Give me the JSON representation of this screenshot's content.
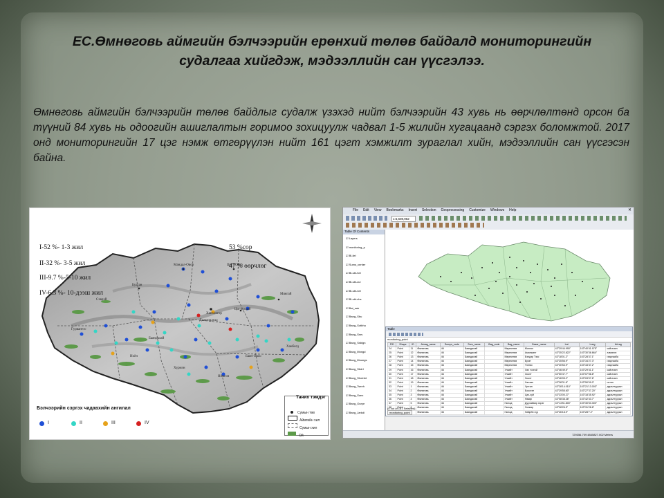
{
  "slide": {
    "title": "ЕС.Өмнөговь аймгийн  бэлчээрийн ерөнхий төлөв байдалд мониторингийн судалгаа  хийгдэж, мэдээллийн сан үүсгэлээ.",
    "paragraph": "Өмнөговь аймгийн бэлчээрийн төлөв байдлыг судалж үзэхэд нийт бэлчээрийн 43 хувь нь өөрчлөлтөнд орсон ба түүний 84 хувь нь одоогийн ашиглалтын горимоо зохицуулж чадвал  1-5 жилийн хугацаанд сэргэх боломжтой. 2017 онд мониторингийн 17 цэг нэмж өтгөрүүлэн нийт 161 цэгт хэмжилт зураглал хийн, мэдээллийн сан үүсгэсэн байна."
  },
  "map": {
    "classes": [
      "I-52 %- 1-3 жил",
      "II-32 %- 3-5 жил",
      "III-9.7 %-5-10 жил",
      "IV-6.3 %- 10-дээш жил"
    ],
    "summary": [
      "53 %сор",
      "47 % өөрчлөг"
    ],
    "place_names": [
      "Мандал-Овоо",
      "Цогт-Овоо",
      "Булган",
      "Сэврэй",
      "Ханбогд",
      "Мянгай",
      "Гурвантэс",
      "Баяндалай",
      "Даланзадгад",
      "Ханхонгор",
      "Цогтцэций",
      "Ноён",
      "Хүрмэн",
      "Баян-Овоо",
      "Номгон"
    ],
    "legend_title": "Таних тэмдэг",
    "legend_items": [
      "Сумын төв",
      "Аймгийн хил",
      "Сумын хил",
      "Ой"
    ],
    "bottom_title": "Бэлчээрийн сэргэх чадавхийн ангилал",
    "bottom_classes": [
      "I",
      "II",
      "III",
      "IV"
    ],
    "class_colors": [
      "#1f4fd6",
      "#33d6c6",
      "#e6a21a",
      "#d62020"
    ]
  },
  "gis": {
    "menu": [
      "File",
      "Edit",
      "View",
      "Bookmarks",
      "Insert",
      "Selection",
      "Geoprocessing",
      "Customize",
      "Windows",
      "Help"
    ],
    "scale": "1:6,608,962",
    "toc_title": "Table Of Contents",
    "layers": [
      "Layers",
      "monitoring_p",
      "Bl-ilel",
      "Sums_center",
      "Bl-ubl-hel",
      "Bl-ubl-zul",
      "Bl-ubl-ner",
      "Bl-ubl-chs",
      "Bai_sair",
      "Bang_Sbu",
      "Bang_Sotbhu",
      "Bang_Ssrs",
      "Bang_Ssblgn",
      "Bang_Mnngd",
      "Bang_Moongs",
      "Bang_Sbdrl",
      "Bang_Shotnbt",
      "Bang_Tseeh",
      "Bang_Sanx",
      "Bang_Ourye",
      "Bang_Jarkdi"
    ],
    "table_title": "Table",
    "table_layer": "monitoring_point",
    "columns": [
      "FID",
      "Shape",
      "ID",
      "Aimag_name",
      "Sumyn_code",
      "Sum_name",
      "Bag_code",
      "Bag_name",
      "Gazar_name",
      "Lat",
      "Long",
      "Urtrag"
    ],
    "rows": [
      [
        "24",
        "Point",
        "11",
        "Өмнөговь",
        "46",
        "Баяндалай",
        "",
        "Мөргөлгөө",
        "Монгол",
        "43°29'44.990\"",
        "103°40'41.975\"",
        "сайгалин"
      ],
      [
        "25",
        "Point",
        "12",
        "Өмнөговь",
        "46",
        "Баяндалай",
        "",
        "Мөргөлгөө",
        "Аманжанг",
        "43°35'22.822\"",
        "103°30'36.664\"",
        "алмагин"
      ],
      [
        "26",
        "Point",
        "13",
        "Өмнөговь",
        "46",
        "Баяндалай",
        "",
        "Мөргөлгөө",
        "Бэлдэр Тэкс",
        "43°18'01.2\"",
        "103°28'37.1\"",
        "гааргааба"
      ],
      [
        "27",
        "Point",
        "14",
        "Өмнөговь",
        "46",
        "Баяндалай",
        "",
        "Мөргөлгөө",
        "Бугат",
        "43°35'56.9\"",
        "103°34'27.3\"",
        "гааргааба"
      ],
      [
        "28",
        "Point",
        "15",
        "Өмнөговь",
        "46",
        "Баяндалай",
        "",
        "Мөргөлгөө",
        "Тэнгис",
        "43°30'54.9\"",
        "103°43'47.2\"",
        "гааргааба"
      ],
      [
        "29",
        "Point",
        "16",
        "Өмнөговь",
        "46",
        "Баяндалай",
        "",
        "Улзийт",
        "Хөх толгой",
        "43°46'49.5\"",
        "103°29'41.1\"",
        "сайгалин"
      ],
      [
        "30",
        "Point",
        "17",
        "Өмнөговь",
        "46",
        "Баяндалай",
        "",
        "Улзийт",
        "Зоолт",
        "43°50'47.7\"",
        "103°07'56.8\"",
        "сайгалин"
      ],
      [
        "31",
        "Point",
        "18",
        "Өмнөговь",
        "46",
        "Баяндалай",
        "",
        "Улзийт",
        "Зоолт",
        "43°46'05.2\"",
        "103°03'07.6\"",
        "сайгалин"
      ],
      [
        "32",
        "Point",
        "19",
        "Өмнөговь",
        "46",
        "Баяндалай",
        "",
        "Улзийт",
        "Халзан",
        "43°38'31.8\"",
        "103°50'09.0\"",
        "остин"
      ],
      [
        "33",
        "Point",
        "1",
        "Өмнөговь",
        "46",
        "Баяндалай",
        "",
        "Улзийт",
        "Уртган",
        "43°28'14.010\"",
        "103°21'13.003\"",
        "даралтуурын"
      ],
      [
        "34",
        "Point",
        "2",
        "Өмнөговь",
        "46",
        "Баяндалай",
        "",
        "Улзийт",
        "Боосгэн",
        "43°29'55.60\"",
        "103°27'37.20\"",
        "даралтуурын"
      ],
      [
        "35",
        "Point",
        "3",
        "Өмнөговь",
        "46",
        "Баяндалай",
        "",
        "Улзийт",
        "Цэх-хуй",
        "43°33'00.27\"",
        "103°18'35.92\"",
        "даралтуурын"
      ],
      [
        "36",
        "Point",
        "4",
        "Өмнөговь",
        "46",
        "Баяндалай",
        "",
        "Улзийт",
        "Нөкөр",
        "43°08'38.38\"",
        "103°42'43.7\"",
        "даралтуурын"
      ],
      [
        "37",
        "Point",
        "5",
        "Өмнөговь",
        "46",
        "Баяндалай",
        "",
        "Гангад",
        "Дуулайвир хэрэг",
        "43°14'51.800\"",
        "103°30'53.300\"",
        "даралтуурын"
      ],
      [
        "38",
        "Point",
        "6",
        "Өмнөговь",
        "46",
        "Баяндалай",
        "",
        "Гангад",
        "Зэнмэр",
        "43°28'26.5\"",
        "103°31'28.8\"",
        "даралтуурын"
      ],
      [
        "39",
        "Point",
        "7",
        "Өмнөговь",
        "46",
        "Баяндалай",
        "",
        "Гангад",
        "Найрбн хүр",
        "43°26'18.9\"",
        "103°28'7.2\"",
        "даралтуурын"
      ]
    ],
    "records": "(0 out of 161 Selected)",
    "tab_label": "monitoring_point",
    "status": "729356.709 4845827.002 Meters"
  }
}
